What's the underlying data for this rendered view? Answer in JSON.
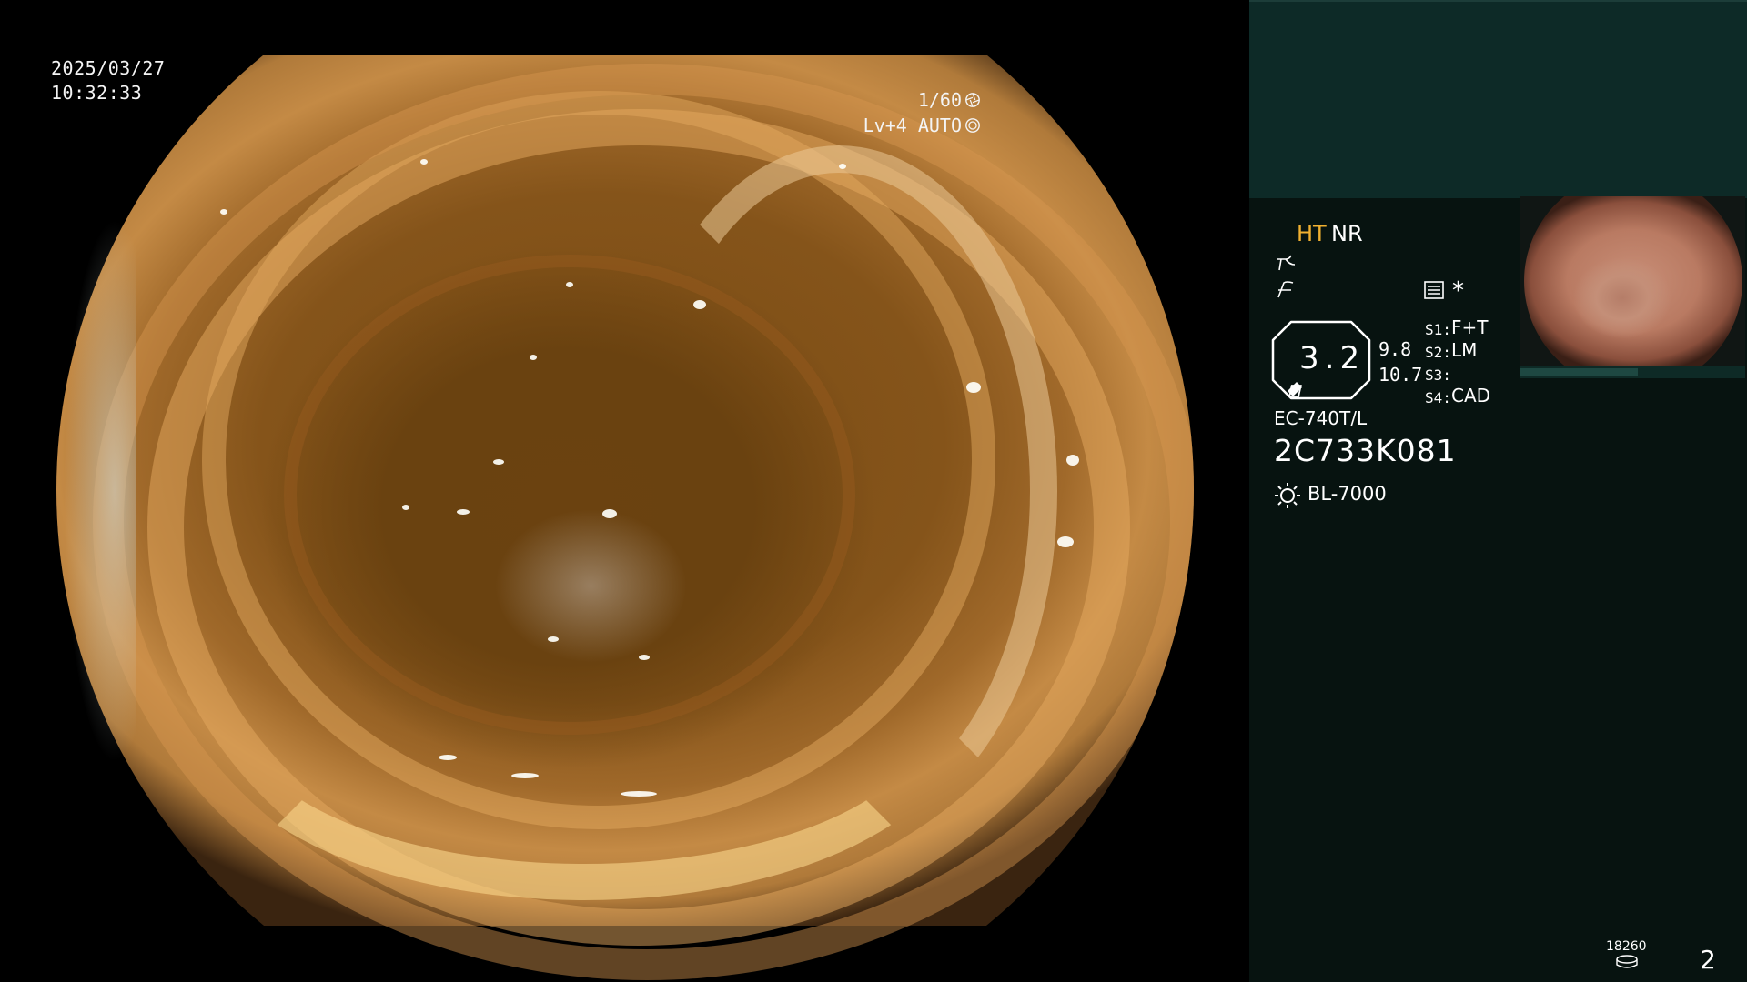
{
  "overlay": {
    "date": "2025/03/27",
    "time": "10:32:33",
    "shutter": "1/60",
    "level": "Lv+4",
    "auto_mode": "AUTO"
  },
  "panel": {
    "ht_label": "HT",
    "nr_label": "NR",
    "asterisk": "*",
    "hex_value": "3.2",
    "value_top": "9.8",
    "value_bottom": "10.7",
    "switches": [
      {
        "label": "S1:",
        "value": "F+T"
      },
      {
        "label": "S2:",
        "value": "LM"
      },
      {
        "label": "S3:",
        "value": ""
      },
      {
        "label": "S4:",
        "value": "CAD"
      }
    ],
    "scope_model": "EC-740T/L",
    "serial_number": "2C733K081",
    "light_source": "BL-7000",
    "storage_count": "18260",
    "page_number": "2"
  },
  "colors": {
    "accent": "#f0b030",
    "panel_bg": "#071310",
    "panel_top_bg": "#0d2a27"
  },
  "icons": {
    "shutter": "aperture-icon",
    "auto": "iris-icon",
    "lamp": "sun-icon",
    "storage": "disk-icon"
  }
}
